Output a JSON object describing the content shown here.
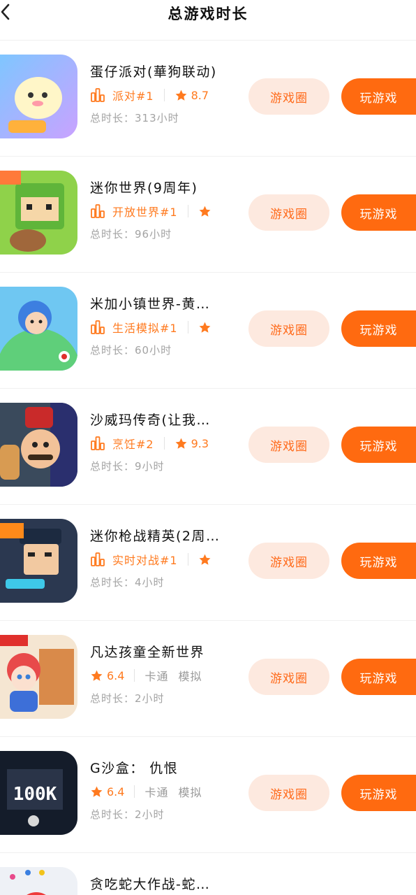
{
  "header": {
    "title": "总游戏时长",
    "back_icon": "chevron-left-icon"
  },
  "colors": {
    "accent": "#ff6a10",
    "accent_text": "#ff7a1f",
    "circle_bg": "#fde9df",
    "muted": "#a3a3a3"
  },
  "list": [
    {
      "name": "蛋仔派对(華狗联动)",
      "rank": "派对#1",
      "score": "8.7",
      "playtime_label": "总时长：",
      "playtime": "313小时",
      "circle_label": "游戏圈",
      "play_label": "玩游戏"
    },
    {
      "name": "迷你世界(9周年)",
      "rank": "开放世界#1",
      "score": "",
      "playtime_label": "总时长：",
      "playtime": "96小时",
      "circle_label": "游戏圈",
      "play_label": "玩游戏"
    },
    {
      "name": "米加小镇世界-黄…",
      "rank": "生活模拟#1",
      "score": "",
      "playtime_label": "总时长：",
      "playtime": "60小时",
      "circle_label": "游戏圈",
      "play_label": "玩游戏"
    },
    {
      "name": "沙威玛传奇(让我…",
      "rank": "烹饪#2",
      "score": "9.3",
      "playtime_label": "总时长：",
      "playtime": "9小时",
      "circle_label": "游戏圈",
      "play_label": "玩游戏"
    },
    {
      "name": "迷你枪战精英(2周…",
      "rank": "实时对战#1",
      "score": "",
      "playtime_label": "总时长：",
      "playtime": "4小时",
      "circle_label": "游戏圈",
      "play_label": "玩游戏"
    },
    {
      "name": "凡达孩童全新世界",
      "score": "6.4",
      "tags": [
        "卡通",
        "模拟"
      ],
      "playtime_label": "总时长：",
      "playtime": "2小时",
      "circle_label": "游戏圈",
      "play_label": "玩游戏"
    },
    {
      "name": "G沙盒： 仇恨",
      "score": "6.4",
      "tags": [
        "卡通",
        "模拟"
      ],
      "playtime_label": "总时长：",
      "playtime": "2小时",
      "circle_label": "游戏圈",
      "play_label": "玩游戏",
      "icon_text": "100K"
    },
    {
      "name": "贪吃蛇大作战-蛇…"
    }
  ]
}
